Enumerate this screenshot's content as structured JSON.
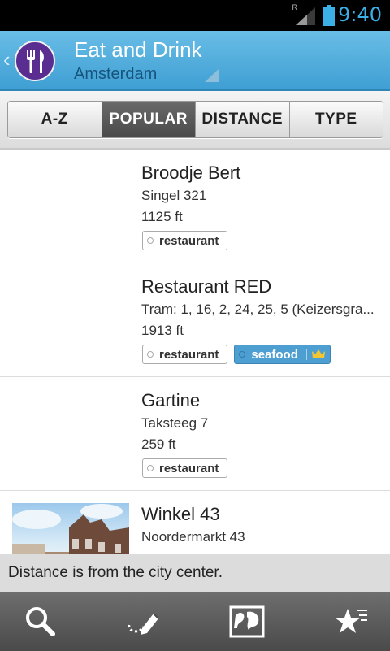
{
  "status": {
    "time": "9:40",
    "roaming": "R"
  },
  "header": {
    "title": "Eat and Drink",
    "subtitle": "Amsterdam"
  },
  "tabs": [
    {
      "label": "A-Z",
      "active": false
    },
    {
      "label": "POPULAR",
      "active": true
    },
    {
      "label": "DISTANCE",
      "active": false
    },
    {
      "label": "TYPE",
      "active": false
    }
  ],
  "items": [
    {
      "name": "Broodje Bert",
      "address": "Singel 321",
      "distance": "1125 ft",
      "tags": [
        "restaurant"
      ]
    },
    {
      "name": "Restaurant RED",
      "address": "Tram: 1, 16, 2, 24, 25, 5 (Keizersgra...",
      "distance": "1913 ft",
      "tags": [
        "restaurant"
      ],
      "premium_tag": "seafood"
    },
    {
      "name": "Gartine",
      "address": "Taksteeg 7",
      "distance": "259 ft",
      "tags": [
        "restaurant"
      ]
    },
    {
      "name": "Winkel 43",
      "address": "Noordermarkt 43",
      "distance": ""
    }
  ],
  "toast": "Distance is from the city center.",
  "colors": {
    "accent": "#3f9fd3",
    "brand": "#5a2d91",
    "premium": "#4e9fd1"
  },
  "bottom_bar": [
    "search-icon",
    "draw-route-icon",
    "map-icon",
    "favorites-star-icon"
  ]
}
